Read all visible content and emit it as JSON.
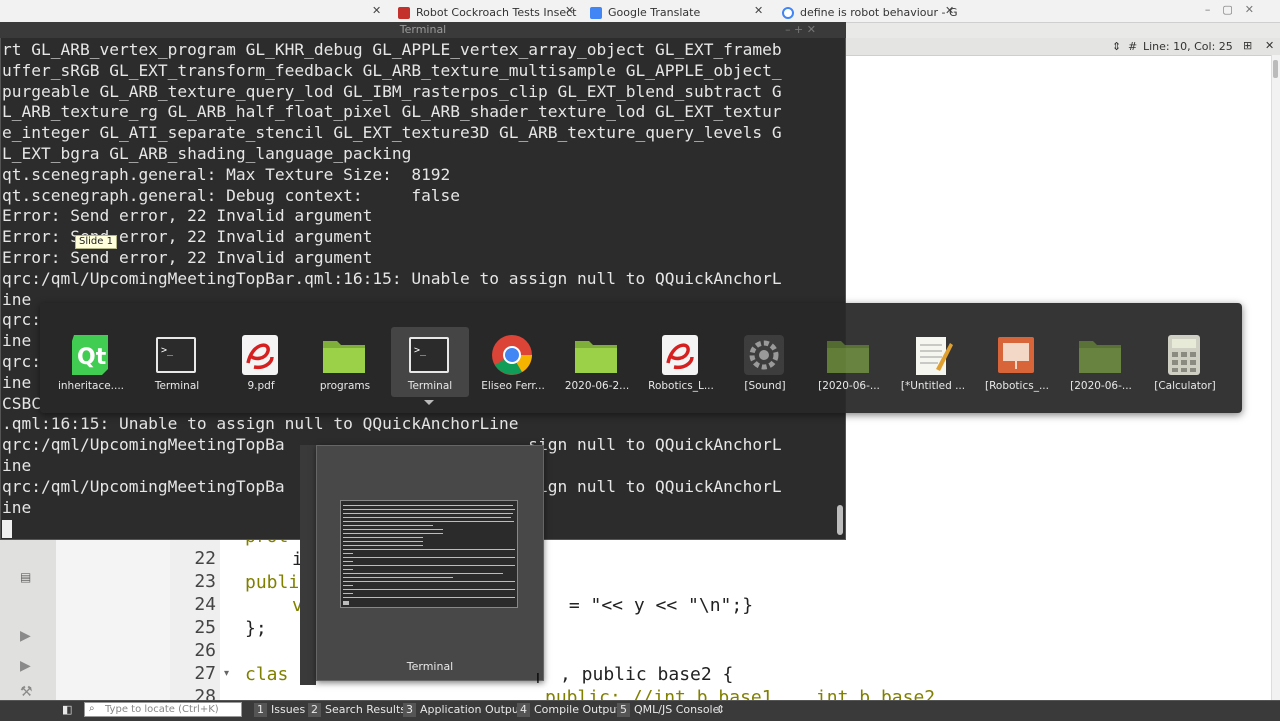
{
  "browser": {
    "tabs": [
      {
        "title": "Robot Cockroach Tests Insect",
        "color": "#c4302b"
      },
      {
        "title": "Google Translate",
        "color": "#4285f4"
      },
      {
        "title": "define is robot behaviour - G",
        "color": "#4285f4"
      }
    ],
    "window_controls": "–▢✕"
  },
  "editor": {
    "status_left": "⇕",
    "status_hash": "#",
    "position": "Line: 10, Col: 25",
    "line_numbers": [
      "22",
      "23",
      "24",
      "25",
      "26",
      "27",
      "28"
    ],
    "code": {
      "l21": "prot",
      "l22": "i",
      "l23": "publi",
      "l24_end": " = \"<< y << \"\\n\";}",
      "l24_v": "v",
      "l25": "};",
      "l27_class": "clas",
      "l27_end": ", public base2 {",
      "l28": "public: //int b_base1    int b_base2"
    }
  },
  "terminal": {
    "title": "Terminal",
    "lines": [
      "rt GL_ARB_vertex_program GL_KHR_debug GL_APPLE_vertex_array_object GL_EXT_frameb",
      "uffer_sRGB GL_EXT_transform_feedback GL_ARB_texture_multisample GL_APPLE_object_",
      "purgeable GL_ARB_texture_query_lod GL_IBM_rasterpos_clip GL_EXT_blend_subtract G",
      "L_ARB_texture_rg GL_ARB_half_float_pixel GL_ARB_shader_texture_lod GL_EXT_textur",
      "e_integer GL_ATI_separate_stencil GL_EXT_texture3D GL_ARB_texture_query_levels G",
      "L_EXT_bgra GL_ARB_shading_language_packing",
      "qt.scenegraph.general: Max Texture Size:  8192",
      "qt.scenegraph.general: Debug context:     false",
      "Error: Send error, 22 Invalid argument",
      "Error: Send error, 22 Invalid argument",
      "Error: Send error, 22 Invalid argument",
      "qrc:/qml/UpcomingMeetingTopBar.qml:16:15: Unable to assign null to QQuickAnchorL",
      "ine",
      "qrc:",
      "ine",
      "qrc:",
      "ine",
      "CSBC",
      ".qml:16:15: Unable to assign null to QQuickAnchorLine",
      "qrc:/qml/UpcomingMeetingTopBa                         sign null to QQuickAnchorL",
      "ine",
      "qrc:/qml/UpcomingMeetingTopBa                         sign null to QQuickAnchorL",
      "ine"
    ]
  },
  "tooltip": "Slide 1",
  "switcher": {
    "items": [
      {
        "label": "inheritace....",
        "icon": "qt-creator-icon"
      },
      {
        "label": "Terminal",
        "icon": "terminal-icon"
      },
      {
        "label": "9.pdf",
        "icon": "pdf-viewer-icon"
      },
      {
        "label": "programs",
        "icon": "folder-icon"
      },
      {
        "label": "Terminal",
        "icon": "terminal-icon"
      },
      {
        "label": "Eliseo Ferr...",
        "icon": "chrome-icon"
      },
      {
        "label": "2020-06-2...",
        "icon": "folder-icon"
      },
      {
        "label": "Robotics_L...",
        "icon": "pdf-viewer-icon"
      },
      {
        "label": "[Sound]",
        "icon": "sound-settings-icon"
      },
      {
        "label": "[2020-06-...",
        "icon": "folder-icon"
      },
      {
        "label": "[*Untitled ...",
        "icon": "text-editor-icon"
      },
      {
        "label": "[Robotics_...",
        "icon": "presentation-icon"
      },
      {
        "label": "[2020-06-...",
        "icon": "folder-icon"
      },
      {
        "label": "[Calculator]",
        "icon": "calculator-icon"
      }
    ],
    "selected_index": 4
  },
  "preview": {
    "label": "Terminal"
  },
  "bottombar": {
    "locator_placeholder": "Type to locate (Ctrl+K)",
    "panes": [
      {
        "num": "1",
        "label": "Issues"
      },
      {
        "num": "2",
        "label": "Search Results"
      },
      {
        "num": "3",
        "label": "Application Output"
      },
      {
        "num": "4",
        "label": "Compile Output"
      },
      {
        "num": "5",
        "label": "QML/JS Console"
      }
    ]
  }
}
